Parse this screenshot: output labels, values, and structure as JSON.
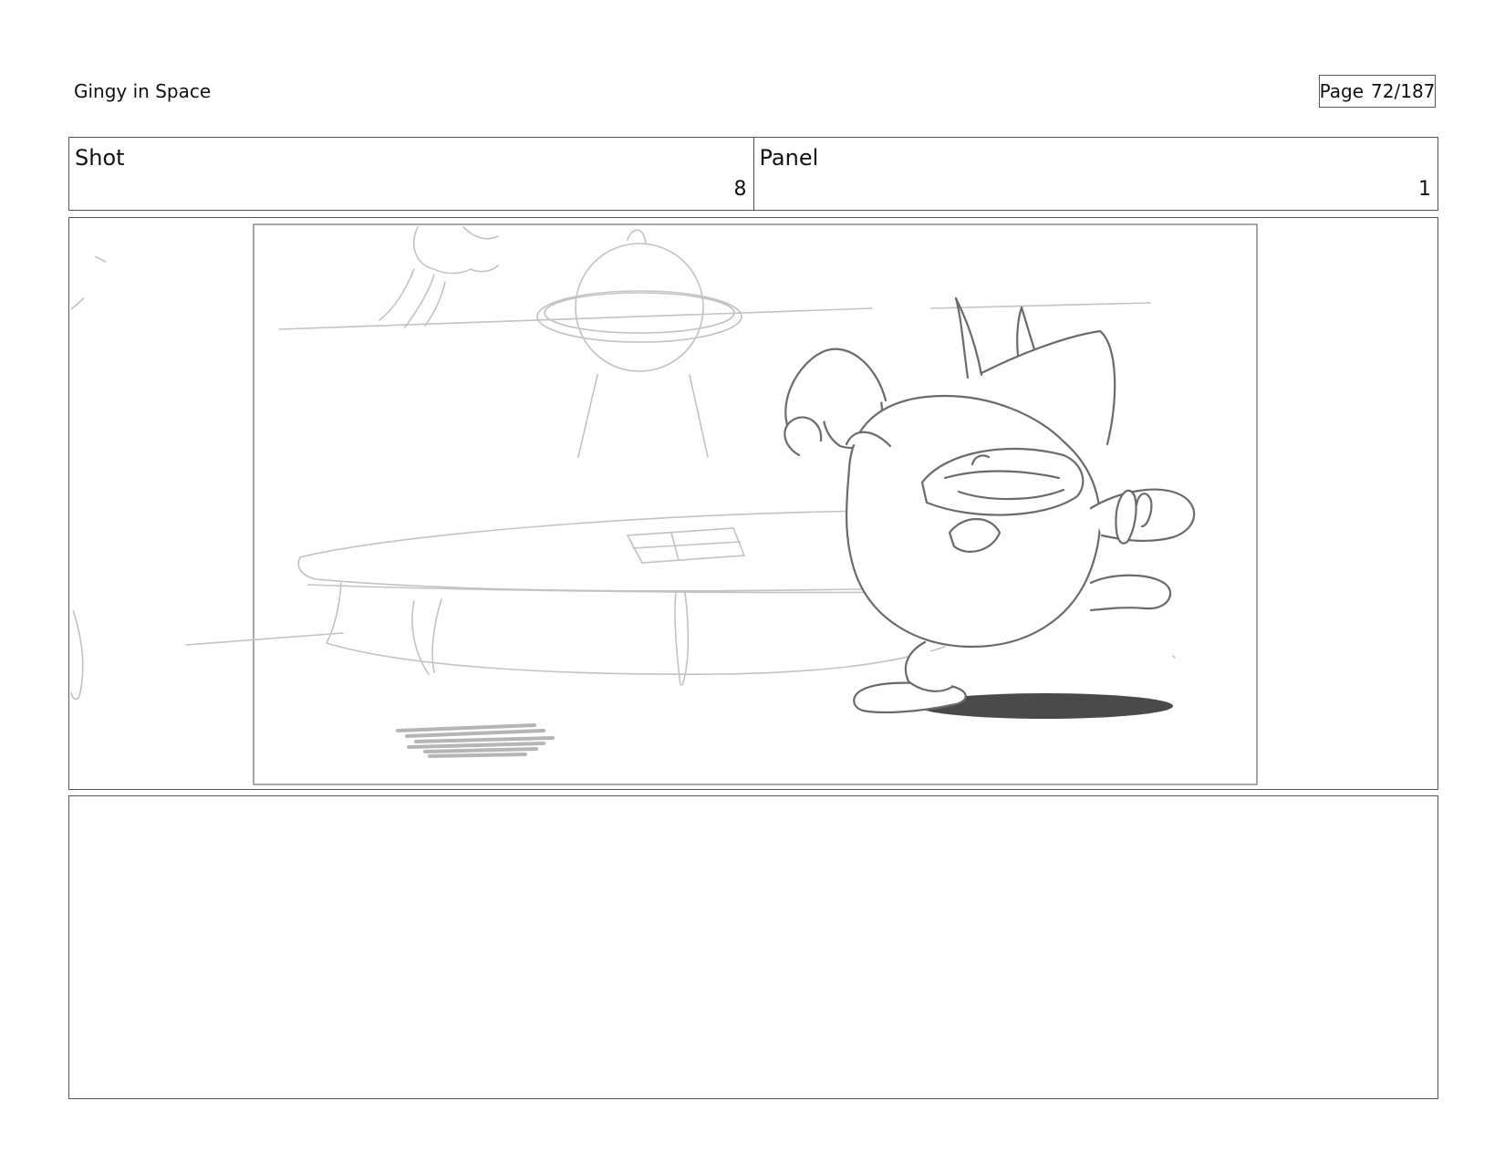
{
  "header": {
    "project_title": "Gingy in Space",
    "page_label": "Page",
    "page_number": "72/187"
  },
  "shot": {
    "label": "Shot",
    "value": "8"
  },
  "panel": {
    "label": "Panel",
    "value": "1"
  },
  "notes": {
    "text": ""
  }
}
